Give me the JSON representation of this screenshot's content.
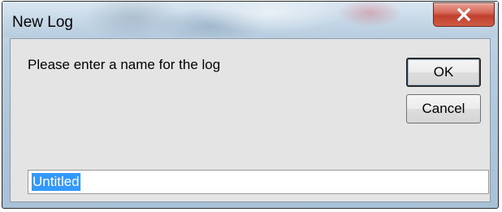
{
  "window": {
    "title": "New Log",
    "close_icon": "close-x-icon",
    "accent_close": "#c94a3a"
  },
  "dialog": {
    "prompt": "Please enter a name for the log",
    "ok_label": "OK",
    "cancel_label": "Cancel"
  },
  "name_input": {
    "value": "Untitled",
    "selected": true
  }
}
